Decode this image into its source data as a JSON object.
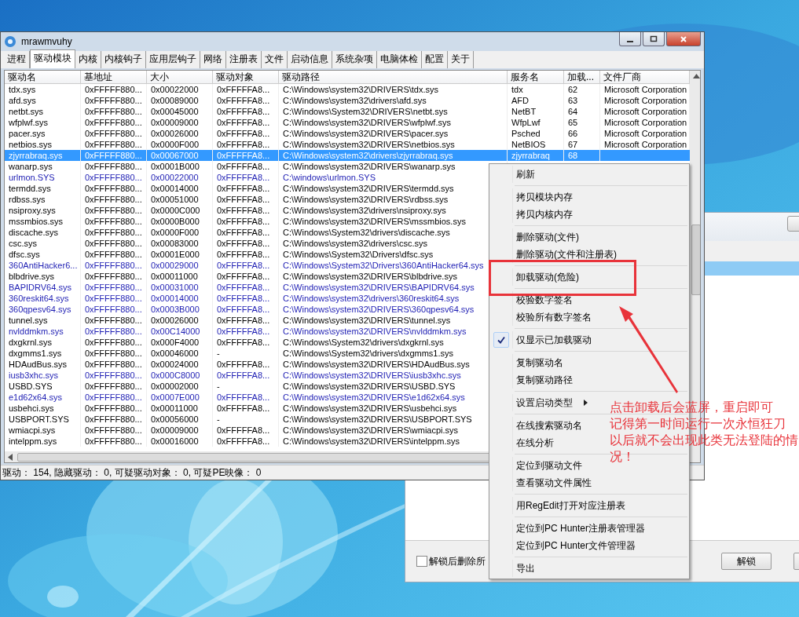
{
  "window": {
    "title": "mrawmvuhy"
  },
  "tabs": [
    {
      "label": "进程",
      "selected": false
    },
    {
      "label": "驱动模块",
      "selected": true
    },
    {
      "label": "内核",
      "selected": false
    },
    {
      "label": "内核钩子",
      "selected": false
    },
    {
      "label": "应用层钩子",
      "selected": false
    },
    {
      "label": "网络",
      "selected": false
    },
    {
      "label": "注册表",
      "selected": false
    },
    {
      "label": "文件",
      "selected": false
    },
    {
      "label": "启动信息",
      "selected": false
    },
    {
      "label": "系统杂项",
      "selected": false
    },
    {
      "label": "电脑体检",
      "selected": false
    },
    {
      "label": "配置",
      "selected": false
    },
    {
      "label": "关于",
      "selected": false
    }
  ],
  "table": {
    "columns": [
      "驱动名",
      "基地址",
      "大小",
      "驱动对象",
      "驱动路径",
      "服务名",
      "加载...",
      "文件厂商"
    ],
    "rows": [
      {
        "cells": [
          "tdx.sys",
          "0xFFFFF880...",
          "0x00022000",
          "0xFFFFFA8...",
          "C:\\Windows\\system32\\DRIVERS\\tdx.sys",
          "tdx",
          "62",
          "Microsoft Corporation"
        ],
        "flagged": false,
        "selected": false
      },
      {
        "cells": [
          "afd.sys",
          "0xFFFFF880...",
          "0x00089000",
          "0xFFFFFA8...",
          "C:\\Windows\\system32\\drivers\\afd.sys",
          "AFD",
          "63",
          "Microsoft Corporation"
        ],
        "flagged": false,
        "selected": false
      },
      {
        "cells": [
          "netbt.sys",
          "0xFFFFF880...",
          "0x00045000",
          "0xFFFFFA8...",
          "C:\\Windows\\System32\\DRIVERS\\netbt.sys",
          "NetBT",
          "64",
          "Microsoft Corporation"
        ],
        "flagged": false,
        "selected": false
      },
      {
        "cells": [
          "wfplwf.sys",
          "0xFFFFF880...",
          "0x00009000",
          "0xFFFFFA8...",
          "C:\\Windows\\system32\\DRIVERS\\wfplwf.sys",
          "WfpLwf",
          "65",
          "Microsoft Corporation"
        ],
        "flagged": false,
        "selected": false
      },
      {
        "cells": [
          "pacer.sys",
          "0xFFFFF880...",
          "0x00026000",
          "0xFFFFFA8...",
          "C:\\Windows\\system32\\DRIVERS\\pacer.sys",
          "Psched",
          "66",
          "Microsoft Corporation"
        ],
        "flagged": false,
        "selected": false
      },
      {
        "cells": [
          "netbios.sys",
          "0xFFFFF880...",
          "0x0000F000",
          "0xFFFFFA8...",
          "C:\\Windows\\system32\\DRIVERS\\netbios.sys",
          "NetBIOS",
          "67",
          "Microsoft Corporation"
        ],
        "flagged": false,
        "selected": false
      },
      {
        "cells": [
          "zjyrrabraq.sys",
          "0xFFFFF880...",
          "0x00067000",
          "0xFFFFFA8...",
          "C:\\Windows\\system32\\drivers\\zjyrrabraq.sys",
          "zjyrrabraq",
          "68"
        ],
        "flagged": false,
        "selected": true
      },
      {
        "cells": [
          "wanarp.sys",
          "0xFFFFF880...",
          "0x0001B000",
          "0xFFFFFA8...",
          "C:\\Windows\\system32\\DRIVERS\\wanarp.sys"
        ],
        "flagged": false,
        "selected": false
      },
      {
        "cells": [
          "urlmon.SYS",
          "0xFFFFF880...",
          "0x00022000",
          "0xFFFFFA8...",
          "C:\\windows\\urlmon.SYS"
        ],
        "flagged": true,
        "selected": false
      },
      {
        "cells": [
          "termdd.sys",
          "0xFFFFF880...",
          "0x00014000",
          "0xFFFFFA8...",
          "C:\\Windows\\system32\\DRIVERS\\termdd.sys"
        ],
        "flagged": false,
        "selected": false
      },
      {
        "cells": [
          "rdbss.sys",
          "0xFFFFF880...",
          "0x00051000",
          "0xFFFFFA8...",
          "C:\\Windows\\system32\\DRIVERS\\rdbss.sys"
        ],
        "flagged": false,
        "selected": false
      },
      {
        "cells": [
          "nsiproxy.sys",
          "0xFFFFF880...",
          "0x0000C000",
          "0xFFFFFA8...",
          "C:\\Windows\\system32\\drivers\\nsiproxy.sys"
        ],
        "flagged": false,
        "selected": false
      },
      {
        "cells": [
          "mssmbios.sys",
          "0xFFFFF880...",
          "0x0000B000",
          "0xFFFFFA8...",
          "C:\\Windows\\system32\\DRIVERS\\mssmbios.sys"
        ],
        "flagged": false,
        "selected": false
      },
      {
        "cells": [
          "discache.sys",
          "0xFFFFF880...",
          "0x0000F000",
          "0xFFFFFA8...",
          "C:\\Windows\\System32\\drivers\\discache.sys"
        ],
        "flagged": false,
        "selected": false
      },
      {
        "cells": [
          "csc.sys",
          "0xFFFFF880...",
          "0x00083000",
          "0xFFFFFA8...",
          "C:\\Windows\\system32\\drivers\\csc.sys"
        ],
        "flagged": false,
        "selected": false
      },
      {
        "cells": [
          "dfsc.sys",
          "0xFFFFF880...",
          "0x0001E000",
          "0xFFFFFA8...",
          "C:\\Windows\\System32\\Drivers\\dfsc.sys"
        ],
        "flagged": false,
        "selected": false
      },
      {
        "cells": [
          "360AntiHacker6...",
          "0xFFFFF880...",
          "0x00029000",
          "0xFFFFFA8...",
          "C:\\Windows\\System32\\Drivers\\360AntiHacker64.sys"
        ],
        "flagged": true,
        "selected": false
      },
      {
        "cells": [
          "blbdrive.sys",
          "0xFFFFF880...",
          "0x00011000",
          "0xFFFFFA8...",
          "C:\\Windows\\system32\\DRIVERS\\blbdrive.sys"
        ],
        "flagged": false,
        "selected": false
      },
      {
        "cells": [
          "BAPIDRV64.sys",
          "0xFFFFF880...",
          "0x00031000",
          "0xFFFFFA8...",
          "C:\\Windows\\system32\\DRIVERS\\BAPIDRV64.sys"
        ],
        "flagged": true,
        "selected": false
      },
      {
        "cells": [
          "360reskit64.sys",
          "0xFFFFF880...",
          "0x00014000",
          "0xFFFFFA8...",
          "C:\\Windows\\system32\\drivers\\360reskit64.sys"
        ],
        "flagged": true,
        "selected": false
      },
      {
        "cells": [
          "360qpesv64.sys",
          "0xFFFFF880...",
          "0x0003B000",
          "0xFFFFFA8...",
          "C:\\Windows\\system32\\DRIVERS\\360qpesv64.sys"
        ],
        "flagged": true,
        "selected": false
      },
      {
        "cells": [
          "tunnel.sys",
          "0xFFFFF880...",
          "0x00026000",
          "0xFFFFFA8...",
          "C:\\Windows\\system32\\DRIVERS\\tunnel.sys"
        ],
        "flagged": false,
        "selected": false
      },
      {
        "cells": [
          "nvlddmkm.sys",
          "0xFFFFF880...",
          "0x00C14000",
          "0xFFFFFA8...",
          "C:\\Windows\\system32\\DRIVERS\\nvlddmkm.sys"
        ],
        "flagged": true,
        "selected": false
      },
      {
        "cells": [
          "dxgkrnl.sys",
          "0xFFFFF880...",
          "0x000F4000",
          "0xFFFFFA8...",
          "C:\\Windows\\System32\\drivers\\dxgkrnl.sys"
        ],
        "flagged": false,
        "selected": false
      },
      {
        "cells": [
          "dxgmms1.sys",
          "0xFFFFF880...",
          "0x00046000",
          "-",
          "C:\\Windows\\System32\\drivers\\dxgmms1.sys"
        ],
        "flagged": false,
        "selected": false
      },
      {
        "cells": [
          "HDAudBus.sys",
          "0xFFFFF880...",
          "0x00024000",
          "0xFFFFFA8...",
          "C:\\Windows\\system32\\DRIVERS\\HDAudBus.sys"
        ],
        "flagged": false,
        "selected": false
      },
      {
        "cells": [
          "iusb3xhc.sys",
          "0xFFFFF880...",
          "0x000C8000",
          "0xFFFFFA8...",
          "C:\\Windows\\system32\\DRIVERS\\iusb3xhc.sys"
        ],
        "flagged": true,
        "selected": false
      },
      {
        "cells": [
          "USBD.SYS",
          "0xFFFFF880...",
          "0x00002000",
          "-",
          "C:\\Windows\\system32\\DRIVERS\\USBD.SYS"
        ],
        "flagged": false,
        "selected": false
      },
      {
        "cells": [
          "e1d62x64.sys",
          "0xFFFFF880...",
          "0x0007E000",
          "0xFFFFFA8...",
          "C:\\Windows\\system32\\DRIVERS\\e1d62x64.sys"
        ],
        "flagged": true,
        "selected": false
      },
      {
        "cells": [
          "usbehci.sys",
          "0xFFFFF880...",
          "0x00011000",
          "0xFFFFFA8...",
          "C:\\Windows\\system32\\DRIVERS\\usbehci.sys"
        ],
        "flagged": false,
        "selected": false
      },
      {
        "cells": [
          "USBPORT.SYS",
          "0xFFFFF880...",
          "0x00056000",
          "-",
          "C:\\Windows\\system32\\DRIVERS\\USBPORT.SYS"
        ],
        "flagged": false,
        "selected": false
      },
      {
        "cells": [
          "wmiacpi.sys",
          "0xFFFFF880...",
          "0x00009000",
          "0xFFFFFA8...",
          "C:\\Windows\\system32\\DRIVERS\\wmiacpi.sys"
        ],
        "flagged": false,
        "selected": false
      },
      {
        "cells": [
          "intelppm.sys",
          "0xFFFFF880...",
          "0x00016000",
          "0xFFFFFA8...",
          "C:\\Windows\\system32\\DRIVERS\\intelppm.sys"
        ],
        "flagged": false,
        "selected": false
      }
    ]
  },
  "status_bar": "驱动： 154, 隐藏驱动： 0, 可疑驱动对象： 0, 可疑PE映像： 0",
  "context_menu": {
    "groups": [
      {
        "items": [
          {
            "label": "刷新",
            "checked": false,
            "submenu": false
          }
        ]
      },
      {
        "items": [
          {
            "label": "拷贝模块内存",
            "checked": false,
            "submenu": false
          },
          {
            "label": "拷贝内核内存",
            "checked": false,
            "submenu": false
          }
        ]
      },
      {
        "items": [
          {
            "label": "删除驱动(文件)",
            "checked": false,
            "submenu": false
          },
          {
            "label": "删除驱动(文件和注册表)",
            "checked": false,
            "submenu": false
          }
        ]
      },
      {
        "items": [
          {
            "label": "卸载驱动(危险)",
            "checked": false,
            "submenu": false
          }
        ]
      },
      {
        "items": [
          {
            "label": "校验数字签名",
            "checked": false,
            "submenu": false
          },
          {
            "label": "校验所有数字签名",
            "checked": false,
            "submenu": false
          }
        ]
      },
      {
        "items": [
          {
            "label": "仅显示已加载驱动",
            "checked": true,
            "submenu": false
          }
        ]
      },
      {
        "items": [
          {
            "label": "复制驱动名",
            "checked": false,
            "submenu": false
          },
          {
            "label": "复制驱动路径",
            "checked": false,
            "submenu": false
          }
        ]
      },
      {
        "items": [
          {
            "label": "设置启动类型",
            "checked": false,
            "submenu": true
          }
        ]
      },
      {
        "items": [
          {
            "label": "在线搜索驱动名",
            "checked": false,
            "submenu": false
          },
          {
            "label": "在线分析",
            "checked": false,
            "submenu": false
          }
        ]
      },
      {
        "items": [
          {
            "label": "定位到驱动文件",
            "checked": false,
            "submenu": false
          },
          {
            "label": "查看驱动文件属性",
            "checked": false,
            "submenu": false
          }
        ]
      },
      {
        "items": [
          {
            "label": "用RegEdit打开对应注册表",
            "checked": false,
            "submenu": false
          }
        ]
      },
      {
        "items": [
          {
            "label": "定位到PC Hunter注册表管理器",
            "checked": false,
            "submenu": false
          },
          {
            "label": "定位到PC Hunter文件管理器",
            "checked": false,
            "submenu": false
          }
        ]
      },
      {
        "items": [
          {
            "label": "导出",
            "checked": false,
            "submenu": false
          }
        ]
      }
    ]
  },
  "annotation": {
    "lines": [
      "点击卸载后会蓝屏，重启即可",
      "记得第一时间运行一次永恒狂刀",
      "以后就不会出现此类无法登陆的情况！"
    ]
  },
  "background_dialog": {
    "checkbox": {
      "label": "解锁后删除所",
      "checked": false
    },
    "buttons": [
      "解锁"
    ]
  }
}
